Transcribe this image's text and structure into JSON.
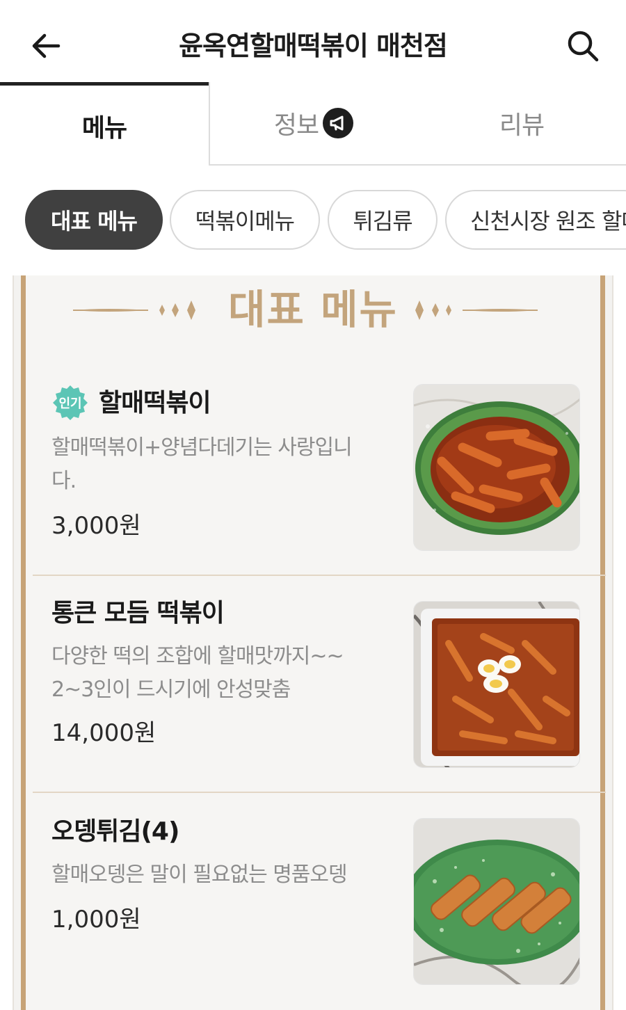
{
  "header": {
    "title": "윤옥연할매떡볶이 매천점",
    "back_icon": "arrow-left-icon",
    "search_icon": "search-icon"
  },
  "tabs": [
    {
      "label": "메뉴",
      "active": true
    },
    {
      "label": "정보",
      "active": false,
      "icon": "megaphone-icon"
    },
    {
      "label": "리뷰",
      "active": false
    }
  ],
  "chips": [
    {
      "label": "대표 메뉴",
      "active": true
    },
    {
      "label": "떡볶이메뉴",
      "active": false
    },
    {
      "label": "튀김류",
      "active": false
    },
    {
      "label": "신천시장 원조 할매",
      "active": false
    }
  ],
  "section": {
    "title": "대표 메뉴",
    "accent_color": "#c3a47c"
  },
  "items": [
    {
      "badge": "인기",
      "name": "할매떡볶이",
      "description_lines": [
        "할매떡볶이+양념다데기는 사랑입니",
        "다."
      ],
      "price": "3,000원",
      "image": "tteokbokki-bowl-image"
    },
    {
      "name": "통큰 모듬 떡볶이",
      "description_lines": [
        "다양한 떡의 조합에 할매맛까지~~",
        "2~3인이 드시기에 안성맞춤"
      ],
      "price": "14,000원",
      "image": "tteokbokki-tray-image"
    },
    {
      "name": "오뎅튀김(4)",
      "description_lines": [
        "할매오뎅은 말이 필요없는 명품오뎅"
      ],
      "price": "1,000원",
      "image": "fried-fishcake-image"
    }
  ],
  "colors": {
    "badge_teal": "#5cc5b5",
    "frame_gold": "#c7a377",
    "chip_active": "#404040"
  }
}
